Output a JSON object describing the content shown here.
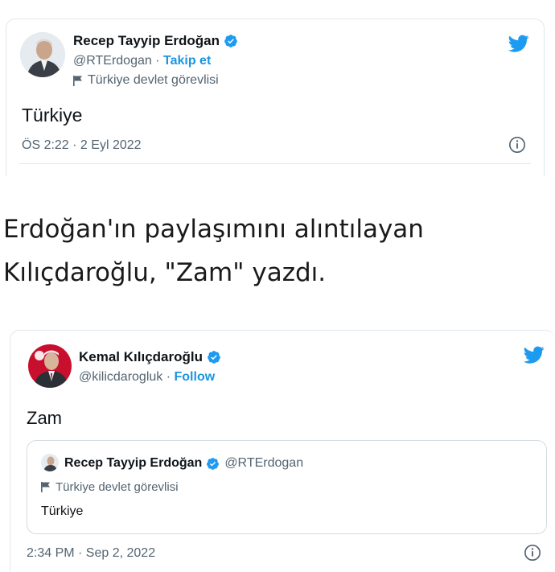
{
  "tweet1": {
    "author_name": "Recep Tayyip Erdoğan",
    "handle": "@RTErdogan",
    "separator": " · ",
    "follow_label": "Takip et",
    "gov_label": "Türkiye devlet görevlisi",
    "text": "Türkiye",
    "timestamp": "ÖS 2:22 · 2 Eyl 2022"
  },
  "article": {
    "caption": "Erdoğan'ın paylaşımını alıntılayan Kılıçdaroğlu, \"Zam\" yazdı."
  },
  "tweet2": {
    "author_name": "Kemal Kılıçdaroğlu",
    "handle": "@kilicdarogluk",
    "separator": " · ",
    "follow_label": "Follow",
    "text": "Zam",
    "timestamp": "2:34 PM · Sep 2, 2022",
    "quoted": {
      "author_name": "Recep Tayyip Erdoğan",
      "handle": "@RTErdogan",
      "gov_label": "Türkiye devlet görevlisi",
      "text": "Türkiye"
    }
  },
  "colors": {
    "twitter_blue": "#1d9bf0",
    "follow_blue": "#1b95e0",
    "muted_text": "#536471",
    "border": "#e1e8ed"
  },
  "icons": [
    "twitter-bird-icon",
    "verified-badge-icon",
    "flag-icon",
    "info-icon"
  ]
}
